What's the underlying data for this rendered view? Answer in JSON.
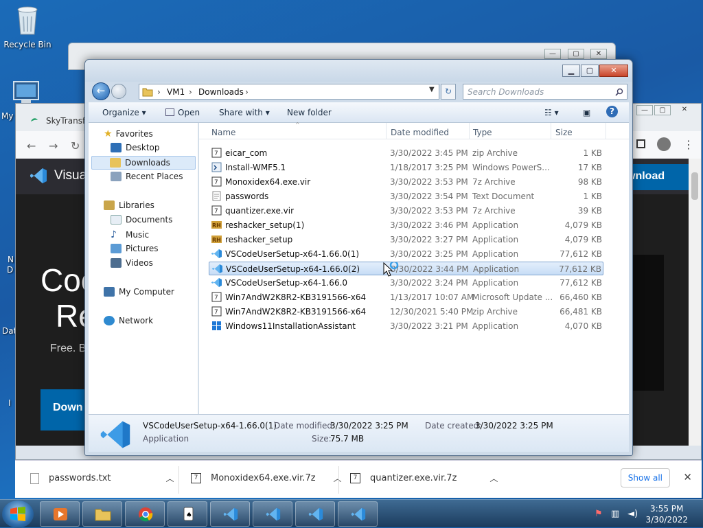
{
  "desktop": {
    "recycle_bin_label": "Recycle Bin",
    "my_computer_partial": "My",
    "partial_labels": [
      "N",
      "D",
      "Dat",
      "I"
    ]
  },
  "back_window": {
    "minimize": "—",
    "maximize": "▢",
    "close": "✕"
  },
  "browser": {
    "tab_title": "SkyTransfe",
    "nav_back": "←",
    "nav_forward": "→",
    "nav_reload": "↻",
    "vs_brand": "Visua",
    "hero_line1": "Coc",
    "hero_line2": "Re",
    "hero_sub": "Free. B",
    "download_top": "wnload",
    "download_main": "Down",
    "window_buttons": {
      "minimize": "—",
      "maximize": "▢",
      "close": "✕"
    }
  },
  "explorer": {
    "caption": {
      "minimize": "▁",
      "maximize": "▢",
      "close": "✕"
    },
    "breadcrumb": [
      "VM1",
      "Downloads"
    ],
    "search_placeholder": "Search Downloads",
    "toolbar": {
      "organize": "Organize",
      "open": "Open",
      "share_with": "Share with",
      "new_folder": "New folder"
    },
    "nav": {
      "favorites": "Favorites",
      "desktop": "Desktop",
      "downloads": "Downloads",
      "recent_places": "Recent Places",
      "libraries": "Libraries",
      "documents": "Documents",
      "music": "Music",
      "pictures": "Pictures",
      "videos": "Videos",
      "my_computer": "My Computer",
      "network": "Network"
    },
    "columns": {
      "name": "Name",
      "date": "Date modified",
      "type": "Type",
      "size": "Size"
    },
    "files": [
      {
        "name": "eicar_com",
        "date": "3/30/2022 3:45 PM",
        "type": "zip Archive",
        "size": "1 KB",
        "icon": "zip"
      },
      {
        "name": "Install-WMF5.1",
        "date": "1/18/2017 3:25 PM",
        "type": "Windows PowerS...",
        "size": "17 KB",
        "icon": "ps"
      },
      {
        "name": "Monoxidex64.exe.vir",
        "date": "3/30/2022 3:53 PM",
        "type": "7z Archive",
        "size": "98 KB",
        "icon": "zip"
      },
      {
        "name": "passwords",
        "date": "3/30/2022 3:54 PM",
        "type": "Text Document",
        "size": "1 KB",
        "icon": "txt"
      },
      {
        "name": "quantizer.exe.vir",
        "date": "3/30/2022 3:53 PM",
        "type": "7z Archive",
        "size": "39 KB",
        "icon": "zip"
      },
      {
        "name": "reshacker_setup(1)",
        "date": "3/30/2022 3:46 PM",
        "type": "Application",
        "size": "4,079 KB",
        "icon": "rh"
      },
      {
        "name": "reshacker_setup",
        "date": "3/30/2022 3:27 PM",
        "type": "Application",
        "size": "4,079 KB",
        "icon": "rh"
      },
      {
        "name": "VSCodeUserSetup-x64-1.66.0(1)",
        "date": "3/30/2022 3:25 PM",
        "type": "Application",
        "size": "77,612 KB",
        "icon": "vs"
      },
      {
        "name": "VSCodeUserSetup-x64-1.66.0(2)",
        "date": "3/30/2022 3:44 PM",
        "type": "Application",
        "size": "77,612 KB",
        "icon": "vs"
      },
      {
        "name": "VSCodeUserSetup-x64-1.66.0",
        "date": "3/30/2022 3:24 PM",
        "type": "Application",
        "size": "77,612 KB",
        "icon": "vs"
      },
      {
        "name": "Win7AndW2K8R2-KB3191566-x64",
        "date": "1/13/2017 10:07 AM",
        "type": "Microsoft Update ...",
        "size": "66,460 KB",
        "icon": "msu"
      },
      {
        "name": "Win7AndW2K8R2-KB3191566-x64",
        "date": "12/30/2021 5:40 PM",
        "type": "zip Archive",
        "size": "66,481 KB",
        "icon": "zip"
      },
      {
        "name": "Windows11InstallationAssistant",
        "date": "3/30/2022 3:21 PM",
        "type": "Application",
        "size": "4,070 KB",
        "icon": "win"
      }
    ],
    "details": {
      "filename": "VSCodeUserSetup-x64-1.66.0(1)",
      "type": "Application",
      "date_modified_label": "Date modified:",
      "date_modified": "3/30/2022 3:25 PM",
      "date_created_label": "Date created:",
      "date_created": "3/30/2022 3:25 PM",
      "size_label": "Size:",
      "size": "75.7 MB"
    }
  },
  "downloads_bar": {
    "items": [
      "passwords.txt",
      "Monoxidex64.exe.vir.7z",
      "quantizer.exe.vir.7z"
    ],
    "show_all": "Show all",
    "close": "✕"
  },
  "taskbar": {
    "time": "3:55 PM",
    "date": "3/30/2022"
  },
  "colors": {
    "vscode_blue": "#2b8ad9",
    "selection": "#cce0f7",
    "taskbar": "#1b3b5d"
  }
}
